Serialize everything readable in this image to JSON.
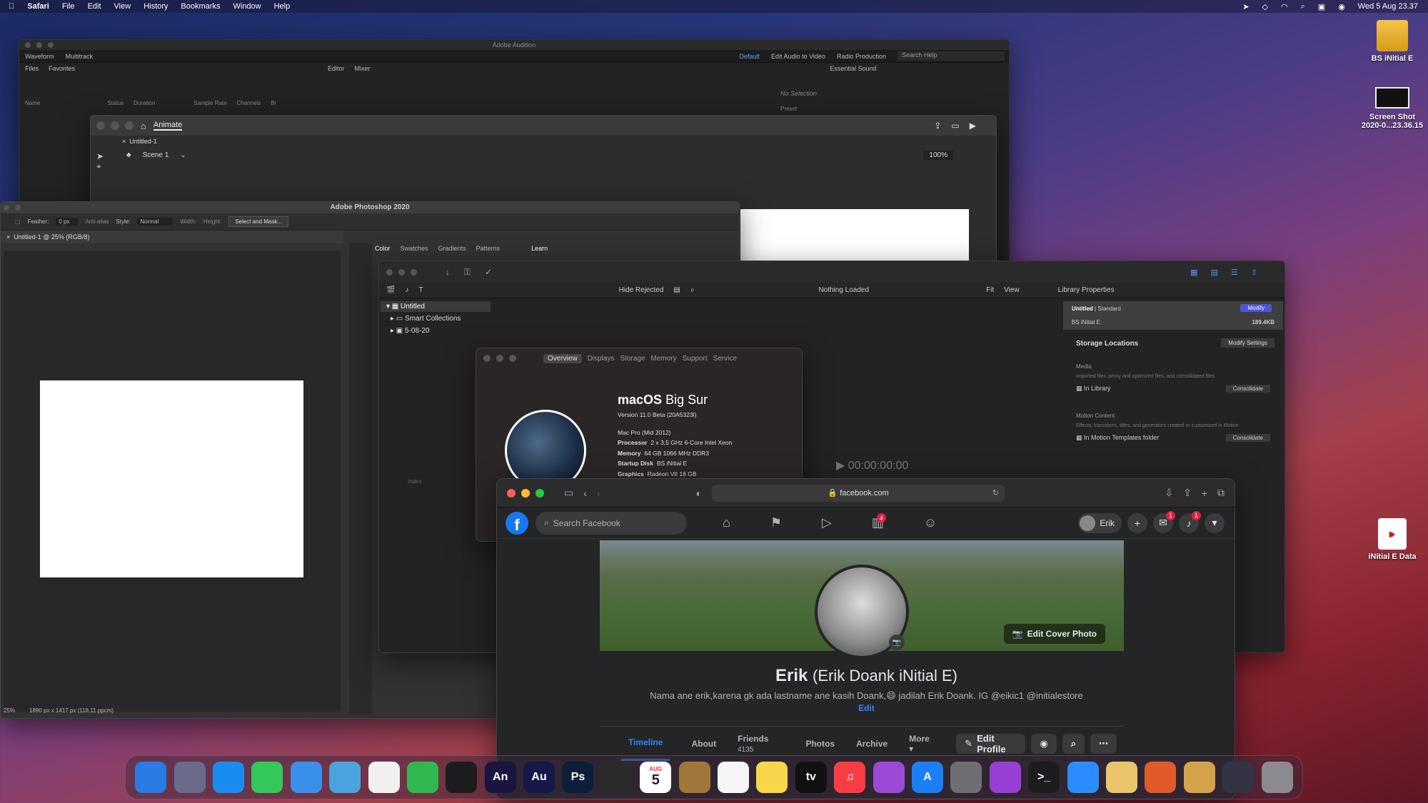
{
  "menubar": {
    "app": "Safari",
    "items": [
      "File",
      "Edit",
      "View",
      "History",
      "Bookmarks",
      "Window",
      "Help"
    ],
    "datetime": "Wed 5 Aug  23.37"
  },
  "desktop": {
    "icons": [
      {
        "label": "BS iNitial E"
      },
      {
        "label": "Screen Shot",
        "label2": "2020-0...23.36.15"
      },
      {
        "label": "iNitial E Data"
      }
    ]
  },
  "audition": {
    "title": "Adobe Audition",
    "modes": [
      "Waveform",
      "Multitrack"
    ],
    "workspaces": [
      "Default",
      "Edit Audio to Video",
      "Radio Production"
    ],
    "search_placeholder": "Search Help",
    "panels": {
      "files": "Files",
      "favorites": "Favorites",
      "editor": "Editor",
      "mixer": "Mixer",
      "essential": "Essential Sound",
      "no_selection": "No Selection",
      "preset": "Preset"
    },
    "columns": [
      "Name",
      "Status",
      "Duration",
      "Sample Rate",
      "Channels",
      "Bi"
    ]
  },
  "animate": {
    "app": "Animate",
    "doc": "Untitled-1",
    "scene": "Scene 1",
    "zoom": "100%"
  },
  "photoshop": {
    "title": "Adobe Photoshop 2020",
    "feather_label": "Feather:",
    "feather": "0 px",
    "anti_alias": "Anti-alias",
    "style_label": "Style:",
    "style": "Normal",
    "width_label": "Width:",
    "height_label": "Height:",
    "mask_button": "Select and Mask...",
    "doc_tab": "Untitled-1 @ 25% (RGB/8)",
    "panel_tabs": [
      "Color",
      "Swatches",
      "Gradients",
      "Patterns"
    ],
    "learn_tab": "Learn",
    "zoom": "25%",
    "status": "1890 px x 1417 px (118,11 ppcm)"
  },
  "fcp": {
    "hide_rejected": "Hide Rejected",
    "library": "Untitled",
    "smart_collections": "Smart Collections",
    "event": "5-08-20",
    "nothing_loaded": "Nothing Loaded",
    "fit": "Fit",
    "view": "View",
    "timecode": "00:00:00:00",
    "lib_props": "Library Properties",
    "lib_name": "Untitled",
    "lib_type": "| Standard",
    "modify": "Modify",
    "drive": "BS iNitial E",
    "drive_size": "189.4KB",
    "storage": "Storage Locations",
    "modify_settings": "Modify Settings",
    "media": "Media",
    "media_desc": "Imported files, proxy and optimized files, and consolidated files",
    "in_library": "In Library",
    "consolidate": "Consolidate",
    "motion": "Motion Content",
    "motion_desc": "Effects, transitions, titles, and generators created or customized in Motion",
    "motion_folder": "In Motion Templates folder",
    "consolidate2": "Consolidate",
    "index": "Index"
  },
  "about": {
    "tabs": [
      "Overview",
      "Displays",
      "Storage",
      "Memory",
      "Support",
      "Service"
    ],
    "os_name": "macOS",
    "os_version_name": "Big Sur",
    "version": "Version 11.0 Beta (20A5323l)",
    "model": "Mac Pro (Mid 2012)",
    "rows": [
      {
        "k": "Processor",
        "v": "2 x 3,5 GHz 6-Core Intel Xeon"
      },
      {
        "k": "Memory",
        "v": "64 GB 1066 MHz DDR3"
      },
      {
        "k": "Startup Disk",
        "v": "BS iNitial E"
      },
      {
        "k": "Graphics",
        "v": "Radeon VII 16 GB"
      }
    ]
  },
  "safari": {
    "url": "facebook.com"
  },
  "facebook": {
    "search_placeholder": "Search Facebook",
    "user": "Erik",
    "badges": {
      "marketplace": "4",
      "messenger": "1",
      "notifications": "1"
    },
    "edit_cover": "Edit Cover Photo",
    "name": "Erik",
    "alt_name": "(Erik Doank iNitial E)",
    "bio": "Nama ane erik,karena gk ada lastname ane kasih Doank,😄 jadilah Erik Doank. IG @eikic1 @initialestore",
    "edit": "Edit",
    "tabs": {
      "timeline": "Timeline",
      "about": "About",
      "friends": "Friends",
      "friends_count": "4135",
      "photos": "Photos",
      "archive": "Archive",
      "more": "More"
    },
    "edit_profile": "Edit Profile"
  },
  "dock": {
    "apps": [
      {
        "label": "",
        "color": "#2a7be4"
      },
      {
        "label": "",
        "color": "#6a6a8a"
      },
      {
        "label": "",
        "color": "#1a8cf0"
      },
      {
        "label": "",
        "color": "#34c759"
      },
      {
        "label": "",
        "color": "#3a8fe8"
      },
      {
        "label": "",
        "color": "#4aa3df"
      },
      {
        "label": "",
        "color": "#f0f0f0"
      },
      {
        "label": "",
        "color": "#2fb84f"
      },
      {
        "label": "",
        "color": "#1c1c1e"
      },
      {
        "label": "An",
        "color": "#1a1440"
      },
      {
        "label": "Au",
        "color": "#16184a"
      },
      {
        "label": "Ps",
        "color": "#0c1e3a"
      },
      {
        "label": "",
        "color": "#2a2a2a"
      },
      {
        "label": "5",
        "color": "#ffffff",
        "month": "AUG"
      },
      {
        "label": "",
        "color": "#a0763a"
      },
      {
        "label": "",
        "color": "#f5f5f5"
      },
      {
        "label": "",
        "color": "#f7d64a"
      },
      {
        "label": "tv",
        "color": "#111111"
      },
      {
        "label": "♫",
        "color": "#fc3c44"
      },
      {
        "label": "",
        "color": "#9b4ad8"
      },
      {
        "label": "A",
        "color": "#1b7ff5"
      },
      {
        "label": "",
        "color": "#6e6e73"
      },
      {
        "label": "",
        "color": "#9a3fd4"
      },
      {
        "label": ">_",
        "color": "#1c1c1e"
      },
      {
        "label": "",
        "color": "#2d8cff"
      },
      {
        "label": "",
        "color": "#e9c46a"
      },
      {
        "label": "",
        "color": "#e05a2a"
      },
      {
        "label": "",
        "color": "#d4a24a"
      },
      {
        "label": "",
        "color": "#333344"
      },
      {
        "label": "",
        "color": "#8a8a8f"
      }
    ]
  }
}
